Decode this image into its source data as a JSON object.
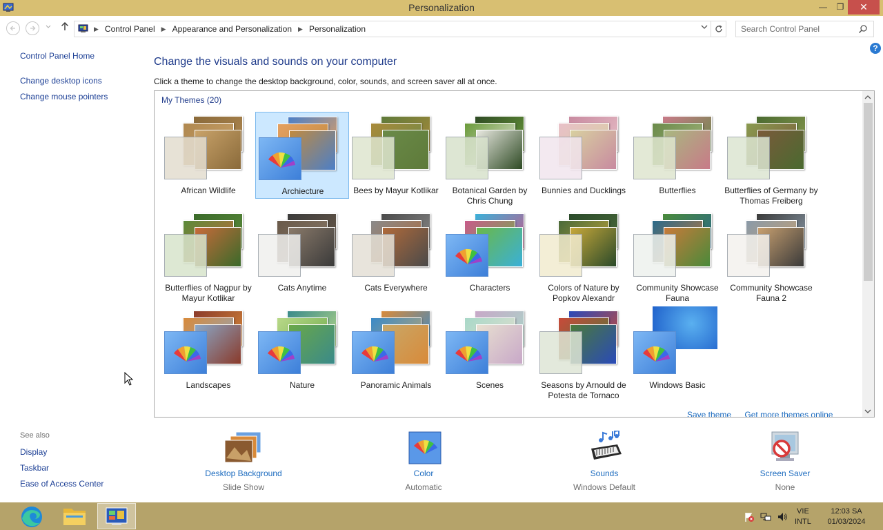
{
  "window": {
    "title": "Personalization",
    "minimize_glyph": "—",
    "maximize_glyph": "❐",
    "close_glyph": "✕"
  },
  "address_bar": {
    "breadcrumbs": [
      "Control Panel",
      "Appearance and Personalization",
      "Personalization"
    ],
    "search_placeholder": "Search Control Panel"
  },
  "left_pane": {
    "home_link": "Control Panel Home",
    "links": [
      "Change desktop icons",
      "Change mouse pointers"
    ],
    "see_also_title": "See also",
    "see_also_links": [
      "Display",
      "Taskbar",
      "Ease of Access Center"
    ]
  },
  "main": {
    "heading": "Change the visuals and sounds on your computer",
    "subheading": "Click a theme to change the desktop background, color, sounds, and screen saver all at once.",
    "group_title": "My Themes (20)",
    "save_theme_link": "Save theme",
    "more_themes_link": "Get more themes online",
    "selected_theme": "Archiecture",
    "themes": [
      {
        "name": "African Wildlife",
        "icon": "photo-stack",
        "colors": [
          "#8a6a3a",
          "#b08850",
          "#c9a36a"
        ],
        "swatch": "#e3ddd0"
      },
      {
        "name": "Archiecture",
        "icon": "color-fan",
        "colors": [
          "#4b7fc8",
          "#e4a060",
          "#c08a40"
        ],
        "swatch": ""
      },
      {
        "name": "Bees by Mayur Kotlikar",
        "icon": "photo-stack",
        "colors": [
          "#5e7a3a",
          "#a98a3a",
          "#6a8a48"
        ],
        "swatch": "#dfe6cf"
      },
      {
        "name": "Botanical Garden by Chris Chung",
        "icon": "photo-stack",
        "colors": [
          "#2e4a24",
          "#6a9a3a",
          "#e8e8e0"
        ],
        "swatch": "#d8e2cc"
      },
      {
        "name": "Bunnies and Ducklings",
        "icon": "photo-stack",
        "colors": [
          "#c88aa0",
          "#e8c0c8",
          "#d8d0a0"
        ],
        "swatch": "#f2e6ee"
      },
      {
        "name": "Butterflies",
        "icon": "photo-stack",
        "colors": [
          "#c87a88",
          "#6a8a4a",
          "#a8b880"
        ],
        "swatch": "#dfe6cf"
      },
      {
        "name": "Butterflies of Germany by Thomas Freiberg",
        "icon": "photo-stack",
        "colors": [
          "#4a6a30",
          "#8a9a50",
          "#7a5a3a"
        ],
        "swatch": "#dce6d2"
      },
      {
        "name": "Butterflies of Nagpur by Mayur Kotlikar",
        "icon": "photo-stack",
        "colors": [
          "#3a6a2a",
          "#5a8a3a",
          "#c86a3a"
        ],
        "swatch": "#d8e4cc"
      },
      {
        "name": "Cats Anytime",
        "icon": "photo-stack",
        "colors": [
          "#3a3a3a",
          "#6a5a4a",
          "#8a7a6a"
        ],
        "swatch": "#f0f0ee"
      },
      {
        "name": "Cats Everywhere",
        "icon": "photo-stack",
        "colors": [
          "#4a4a4a",
          "#8a8a8a",
          "#b06a3a"
        ],
        "swatch": "#e4e0d6"
      },
      {
        "name": "Characters",
        "icon": "color-fan",
        "colors": [
          "#3ab0d8",
          "#c85a8a",
          "#6ab848"
        ],
        "swatch": ""
      },
      {
        "name": "Colors of Nature by Popkov Alexandr",
        "icon": "photo-stack",
        "colors": [
          "#2a4a2a",
          "#4a6a3a",
          "#c8a83a"
        ],
        "swatch": "#f2ecd0"
      },
      {
        "name": "Community Showcase Fauna",
        "icon": "photo-stack",
        "colors": [
          "#4a8a3a",
          "#2a6a8a",
          "#c87a3a"
        ],
        "swatch": "#eef2ee"
      },
      {
        "name": "Community Showcase Fauna 2",
        "icon": "photo-stack",
        "colors": [
          "#3a3a3a",
          "#8a9aa8",
          "#c8a070"
        ],
        "swatch": "#f4f2ee"
      },
      {
        "name": "Landscapes",
        "icon": "color-fan",
        "colors": [
          "#8a3a2a",
          "#d88a3a",
          "#8aa8c8"
        ],
        "swatch": ""
      },
      {
        "name": "Nature",
        "icon": "color-fan",
        "colors": [
          "#3a8a8a",
          "#b8d888",
          "#6aa848"
        ],
        "swatch": ""
      },
      {
        "name": "Panoramic Animals",
        "icon": "color-fan",
        "colors": [
          "#d88a3a",
          "#3a8ac8",
          "#c8a868"
        ],
        "swatch": ""
      },
      {
        "name": "Scenes",
        "icon": "color-fan",
        "colors": [
          "#c8a8c8",
          "#a8d8c8",
          "#e8e0d0"
        ],
        "swatch": ""
      },
      {
        "name": "Seasons by Arnould de Potesta de Tornaco",
        "icon": "photo-stack",
        "colors": [
          "#2a4ab8",
          "#c84a3a",
          "#4a7a3a"
        ],
        "swatch": "#dfe6d6"
      },
      {
        "name": "Windows Basic",
        "icon": "color-fan",
        "colors": [
          "#1a6ad8",
          "#3a8ae8",
          "#1a5ac8"
        ],
        "swatch": ""
      }
    ]
  },
  "settings": [
    {
      "label": "Desktop Background",
      "value": "Slide Show",
      "icon": "desktop-background-icon"
    },
    {
      "label": "Color",
      "value": "Automatic",
      "icon": "color-icon"
    },
    {
      "label": "Sounds",
      "value": "Windows Default",
      "icon": "sounds-icon"
    },
    {
      "label": "Screen Saver",
      "value": "None",
      "icon": "screen-saver-icon"
    }
  ],
  "taskbar": {
    "apps": [
      "edge-icon",
      "file-explorer-icon",
      "control-panel-icon"
    ],
    "language_line1": "VIE",
    "language_line2": "INTL",
    "time": "12:03 SA",
    "date": "01/03/2024"
  },
  "colors": {
    "title_bar": "#d8bf72",
    "taskbar": "#b5a36a",
    "link": "#1c3f95",
    "heading": "#1e3a8a",
    "selection": "#cce8ff"
  }
}
